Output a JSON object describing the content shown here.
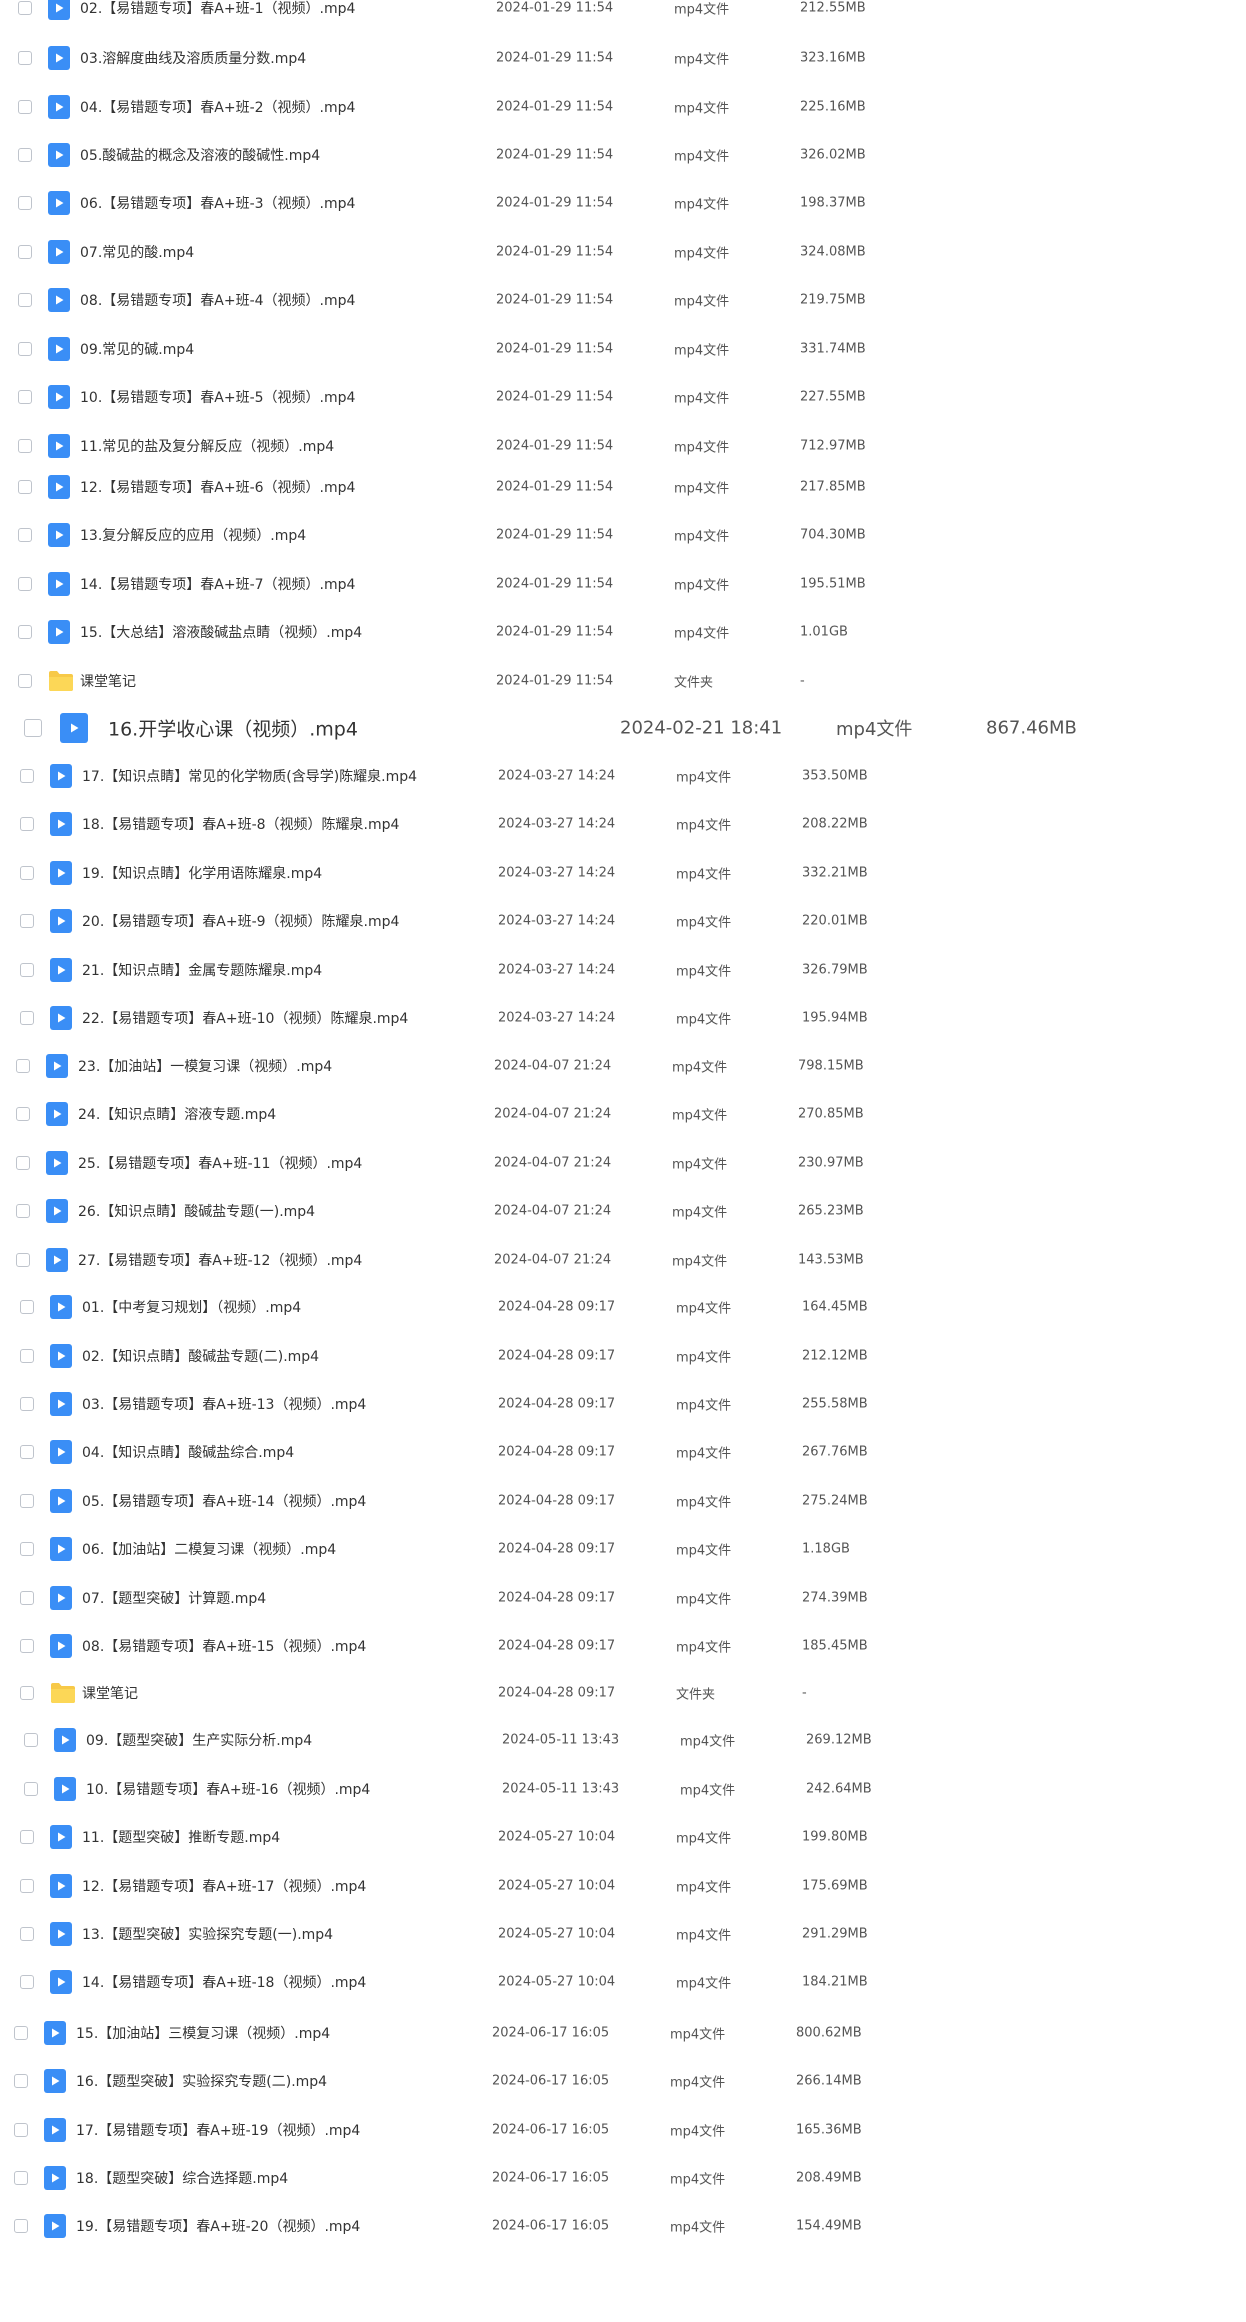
{
  "files": [
    {
      "name": "02.【易错题专项】春A+班-1（视频）.mp4",
      "date": "2024-01-29 11:54",
      "type": "mp4文件",
      "size": "212.55MB",
      "icon": "video-file-icon"
    },
    {
      "name": "03.溶解度曲线及溶质质量分数.mp4",
      "date": "2024-01-29 11:54",
      "type": "mp4文件",
      "size": "323.16MB",
      "icon": "video-file-icon"
    },
    {
      "name": "04.【易错题专项】春A+班-2（视频）.mp4",
      "date": "2024-01-29 11:54",
      "type": "mp4文件",
      "size": "225.16MB",
      "icon": "video-file-icon"
    },
    {
      "name": "05.酸碱盐的概念及溶液的酸碱性.mp4",
      "date": "2024-01-29 11:54",
      "type": "mp4文件",
      "size": "326.02MB",
      "icon": "video-file-icon"
    },
    {
      "name": "06.【易错题专项】春A+班-3（视频）.mp4",
      "date": "2024-01-29 11:54",
      "type": "mp4文件",
      "size": "198.37MB",
      "icon": "video-file-icon"
    },
    {
      "name": "07.常见的酸.mp4",
      "date": "2024-01-29 11:54",
      "type": "mp4文件",
      "size": "324.08MB",
      "icon": "video-file-icon"
    },
    {
      "name": "08.【易错题专项】春A+班-4（视频）.mp4",
      "date": "2024-01-29 11:54",
      "type": "mp4文件",
      "size": "219.75MB",
      "icon": "video-file-icon"
    },
    {
      "name": "09.常见的碱.mp4",
      "date": "2024-01-29 11:54",
      "type": "mp4文件",
      "size": "331.74MB",
      "icon": "video-file-icon"
    },
    {
      "name": "10.【易错题专项】春A+班-5（视频）.mp4",
      "date": "2024-01-29 11:54",
      "type": "mp4文件",
      "size": "227.55MB",
      "icon": "video-file-icon"
    },
    {
      "name": "11.常见的盐及复分解反应（视频）.mp4",
      "date": "2024-01-29 11:54",
      "type": "mp4文件",
      "size": "712.97MB",
      "icon": "video-file-icon"
    },
    {
      "name": "12.【易错题专项】春A+班-6（视频）.mp4",
      "date": "2024-01-29 11:54",
      "type": "mp4文件",
      "size": "217.85MB",
      "icon": "video-file-icon"
    },
    {
      "name": "13.复分解反应的应用（视频）.mp4",
      "date": "2024-01-29 11:54",
      "type": "mp4文件",
      "size": "704.30MB",
      "icon": "video-file-icon"
    },
    {
      "name": "14.【易错题专项】春A+班-7（视频）.mp4",
      "date": "2024-01-29 11:54",
      "type": "mp4文件",
      "size": "195.51MB",
      "icon": "video-file-icon"
    },
    {
      "name": "15.【大总结】溶液酸碱盐点睛（视频）.mp4",
      "date": "2024-01-29 11:54",
      "type": "mp4文件",
      "size": "1.01GB",
      "icon": "video-file-icon"
    },
    {
      "name": "课堂笔记",
      "date": "2024-01-29 11:54",
      "type": "文件夹",
      "size": "-",
      "icon": "folder-icon"
    },
    {
      "name": "16.开学收心课（视频）.mp4",
      "date": "2024-02-21 18:41",
      "type": "mp4文件",
      "size": "867.46MB",
      "icon": "video-file-icon"
    },
    {
      "name": "17.【知识点睛】常见的化学物质(含导学)陈耀泉.mp4",
      "date": "2024-03-27 14:24",
      "type": "mp4文件",
      "size": "353.50MB",
      "icon": "video-file-icon"
    },
    {
      "name": "18.【易错题专项】春A+班-8（视频）陈耀泉.mp4",
      "date": "2024-03-27 14:24",
      "type": "mp4文件",
      "size": "208.22MB",
      "icon": "video-file-icon"
    },
    {
      "name": "19.【知识点睛】化学用语陈耀泉.mp4",
      "date": "2024-03-27 14:24",
      "type": "mp4文件",
      "size": "332.21MB",
      "icon": "video-file-icon"
    },
    {
      "name": "20.【易错题专项】春A+班-9（视频）陈耀泉.mp4",
      "date": "2024-03-27 14:24",
      "type": "mp4文件",
      "size": "220.01MB",
      "icon": "video-file-icon"
    },
    {
      "name": "21.【知识点睛】金属专题陈耀泉.mp4",
      "date": "2024-03-27 14:24",
      "type": "mp4文件",
      "size": "326.79MB",
      "icon": "video-file-icon"
    },
    {
      "name": "22.【易错题专项】春A+班-10（视频）陈耀泉.mp4",
      "date": "2024-03-27 14:24",
      "type": "mp4文件",
      "size": "195.94MB",
      "icon": "video-file-icon"
    },
    {
      "name": "23.【加油站】一模复习课（视频）.mp4",
      "date": "2024-04-07 21:24",
      "type": "mp4文件",
      "size": "798.15MB",
      "icon": "video-file-icon"
    },
    {
      "name": "24.【知识点睛】溶液专题.mp4",
      "date": "2024-04-07 21:24",
      "type": "mp4文件",
      "size": "270.85MB",
      "icon": "video-file-icon"
    },
    {
      "name": "25.【易错题专项】春A+班-11（视频）.mp4",
      "date": "2024-04-07 21:24",
      "type": "mp4文件",
      "size": "230.97MB",
      "icon": "video-file-icon"
    },
    {
      "name": "26.【知识点睛】酸碱盐专题(一).mp4",
      "date": "2024-04-07 21:24",
      "type": "mp4文件",
      "size": "265.23MB",
      "icon": "video-file-icon"
    },
    {
      "name": "27.【易错题专项】春A+班-12（视频）.mp4",
      "date": "2024-04-07 21:24",
      "type": "mp4文件",
      "size": "143.53MB",
      "icon": "video-file-icon"
    },
    {
      "name": "01.【中考复习规划】（视频）.mp4",
      "date": "2024-04-28 09:17",
      "type": "mp4文件",
      "size": "164.45MB",
      "icon": "video-file-icon"
    },
    {
      "name": "02.【知识点睛】酸碱盐专题(二).mp4",
      "date": "2024-04-28 09:17",
      "type": "mp4文件",
      "size": "212.12MB",
      "icon": "video-file-icon"
    },
    {
      "name": "03.【易错题专项】春A+班-13（视频）.mp4",
      "date": "2024-04-28 09:17",
      "type": "mp4文件",
      "size": "255.58MB",
      "icon": "video-file-icon"
    },
    {
      "name": "04.【知识点睛】酸碱盐综合.mp4",
      "date": "2024-04-28 09:17",
      "type": "mp4文件",
      "size": "267.76MB",
      "icon": "video-file-icon"
    },
    {
      "name": "05.【易错题专项】春A+班-14（视频）.mp4",
      "date": "2024-04-28 09:17",
      "type": "mp4文件",
      "size": "275.24MB",
      "icon": "video-file-icon"
    },
    {
      "name": "06.【加油站】二模复习课（视频）.mp4",
      "date": "2024-04-28 09:17",
      "type": "mp4文件",
      "size": "1.18GB",
      "icon": "video-file-icon"
    },
    {
      "name": "07.【题型突破】计算题.mp4",
      "date": "2024-04-28 09:17",
      "type": "mp4文件",
      "size": "274.39MB",
      "icon": "video-file-icon"
    },
    {
      "name": "08.【易错题专项】春A+班-15（视频）.mp4",
      "date": "2024-04-28 09:17",
      "type": "mp4文件",
      "size": "185.45MB",
      "icon": "video-file-icon"
    },
    {
      "name": "课堂笔记",
      "date": "2024-04-28 09:17",
      "type": "文件夹",
      "size": "-",
      "icon": "folder-icon"
    },
    {
      "name": "09.【题型突破】生产实际分析.mp4",
      "date": "2024-05-11 13:43",
      "type": "mp4文件",
      "size": "269.12MB",
      "icon": "video-file-icon"
    },
    {
      "name": "10.【易错题专项】春A+班-16（视频）.mp4",
      "date": "2024-05-11 13:43",
      "type": "mp4文件",
      "size": "242.64MB",
      "icon": "video-file-icon"
    },
    {
      "name": "11.【题型突破】推断专题.mp4",
      "date": "2024-05-27 10:04",
      "type": "mp4文件",
      "size": "199.80MB",
      "icon": "video-file-icon"
    },
    {
      "name": "12.【易错题专项】春A+班-17（视频）.mp4",
      "date": "2024-05-27 10:04",
      "type": "mp4文件",
      "size": "175.69MB",
      "icon": "video-file-icon"
    },
    {
      "name": "13.【题型突破】实验探究专题(一).mp4",
      "date": "2024-05-27 10:04",
      "type": "mp4文件",
      "size": "291.29MB",
      "icon": "video-file-icon"
    },
    {
      "name": "14.【易错题专项】春A+班-18（视频）.mp4",
      "date": "2024-05-27 10:04",
      "type": "mp4文件",
      "size": "184.21MB",
      "icon": "video-file-icon"
    },
    {
      "name": "15.【加油站】三模复习课（视频）.mp4",
      "date": "2024-06-17 16:05",
      "type": "mp4文件",
      "size": "800.62MB",
      "icon": "video-file-icon"
    },
    {
      "name": "16.【题型突破】实验探究专题(二).mp4",
      "date": "2024-06-17 16:05",
      "type": "mp4文件",
      "size": "266.14MB",
      "icon": "video-file-icon"
    },
    {
      "name": "17.【易错题专项】春A+班-19（视频）.mp4",
      "date": "2024-06-17 16:05",
      "type": "mp4文件",
      "size": "165.36MB",
      "icon": "video-file-icon"
    },
    {
      "name": "18.【题型突破】综合选择题.mp4",
      "date": "2024-06-17 16:05",
      "type": "mp4文件",
      "size": "208.49MB",
      "icon": "video-file-icon"
    },
    {
      "name": "19.【易错题专项】春A+班-20（视频）.mp4",
      "date": "2024-06-17 16:05",
      "type": "mp4文件",
      "size": "154.49MB",
      "icon": "video-file-icon"
    }
  ],
  "colors": {
    "video_icon": "#3a8ef6",
    "folder_icon": "#f7c948",
    "text": "#333333"
  }
}
